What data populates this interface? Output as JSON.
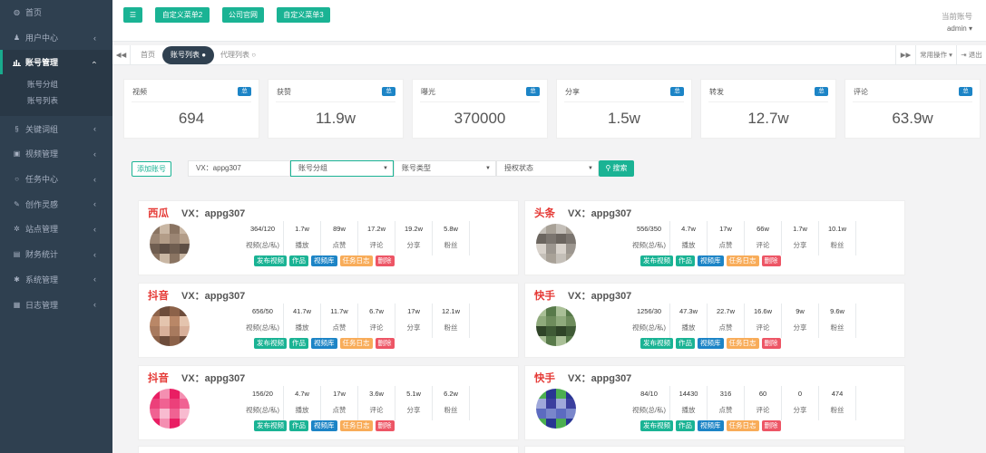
{
  "sidebar": {
    "items": [
      {
        "label": "首页",
        "icon": "home-icon"
      },
      {
        "label": "用户中心",
        "icon": "user-icon"
      },
      {
        "label": "账号管理",
        "icon": "bar-chart-icon",
        "active": true
      },
      {
        "label": "关键词组",
        "icon": "link-icon"
      },
      {
        "label": "视频管理",
        "icon": "video-icon"
      },
      {
        "label": "任务中心",
        "icon": "circle-icon"
      },
      {
        "label": "创作灵感",
        "icon": "pen-icon"
      },
      {
        "label": "站点管理",
        "icon": "gear-icon"
      },
      {
        "label": "财务统计",
        "icon": "finance-icon"
      },
      {
        "label": "系统管理",
        "icon": "settings-icon"
      },
      {
        "label": "日志管理",
        "icon": "log-icon"
      }
    ],
    "submenu": [
      "账号分组",
      "账号列表"
    ]
  },
  "topbar": {
    "menu_icon": "☰",
    "buttons": [
      "自定义菜单2",
      "公司官网",
      "自定义菜单3"
    ],
    "account_title": "当前账号",
    "account_user": "admin"
  },
  "tabs": {
    "home": "首页",
    "active": "账号列表",
    "third": "代理列表",
    "common_ops": "常用操作",
    "logout": "退出"
  },
  "stats": [
    {
      "title": "视频",
      "badge": "总",
      "value": "694"
    },
    {
      "title": "获赞",
      "badge": "总",
      "value": "11.9w"
    },
    {
      "title": "曝光",
      "badge": "总",
      "value": "370000"
    },
    {
      "title": "分享",
      "badge": "总",
      "value": "1.5w"
    },
    {
      "title": "转发",
      "badge": "总",
      "value": "12.7w"
    },
    {
      "title": "评论",
      "badge": "总",
      "value": "63.9w"
    }
  ],
  "filters": {
    "add_button": "添加账号",
    "vx_value": "VX：appg307",
    "group_select": "账号分组",
    "type_select": "账号类型",
    "auth_select": "授权状态",
    "search_button": "搜索"
  },
  "metric_labels": [
    "视频(总/私)",
    "播放",
    "点赞",
    "评论",
    "分享",
    "粉丝"
  ],
  "action_labels": [
    "发布视频",
    "作品",
    "视频库",
    "任务日志",
    "删除"
  ],
  "cards": [
    {
      "platform": "西瓜",
      "vx": "VX：appg307",
      "values": [
        "364/120",
        "1.7w",
        "89w",
        "17.2w",
        "19.2w",
        "5.8w"
      ],
      "avatar": "mosaic-brown"
    },
    {
      "platform": "头条",
      "vx": "VX：appg307",
      "values": [
        "556/350",
        "4.7w",
        "17w",
        "66w",
        "1.7w",
        "10.1w"
      ],
      "avatar": "mosaic-gray"
    },
    {
      "platform": "抖音",
      "vx": "VX：appg307",
      "values": [
        "656/50",
        "41.7w",
        "11.7w",
        "6.7w",
        "17w",
        "12.1w"
      ],
      "avatar": "mosaic-skin"
    },
    {
      "platform": "快手",
      "vx": "VX：appg307",
      "values": [
        "1256/30",
        "47.3w",
        "22.7w",
        "16.6w",
        "9w",
        "9.6w"
      ],
      "avatar": "mosaic-green"
    },
    {
      "platform": "抖音",
      "vx": "VX：appg307",
      "values": [
        "156/20",
        "4.7w",
        "17w",
        "3.6w",
        "5.1w",
        "6.2w"
      ],
      "avatar": "mosaic-pink"
    },
    {
      "platform": "快手",
      "vx": "VX：appg307",
      "values": [
        "84/10",
        "14430",
        "316",
        "60",
        "0",
        "474"
      ],
      "avatar": "mosaic-blue"
    }
  ],
  "colors": {
    "sidebar": "#2f4050",
    "primary": "#1ab394",
    "info": "#1c84c6",
    "warning": "#f8ac59",
    "danger": "#ed5565",
    "platform_red": "#e53935"
  }
}
